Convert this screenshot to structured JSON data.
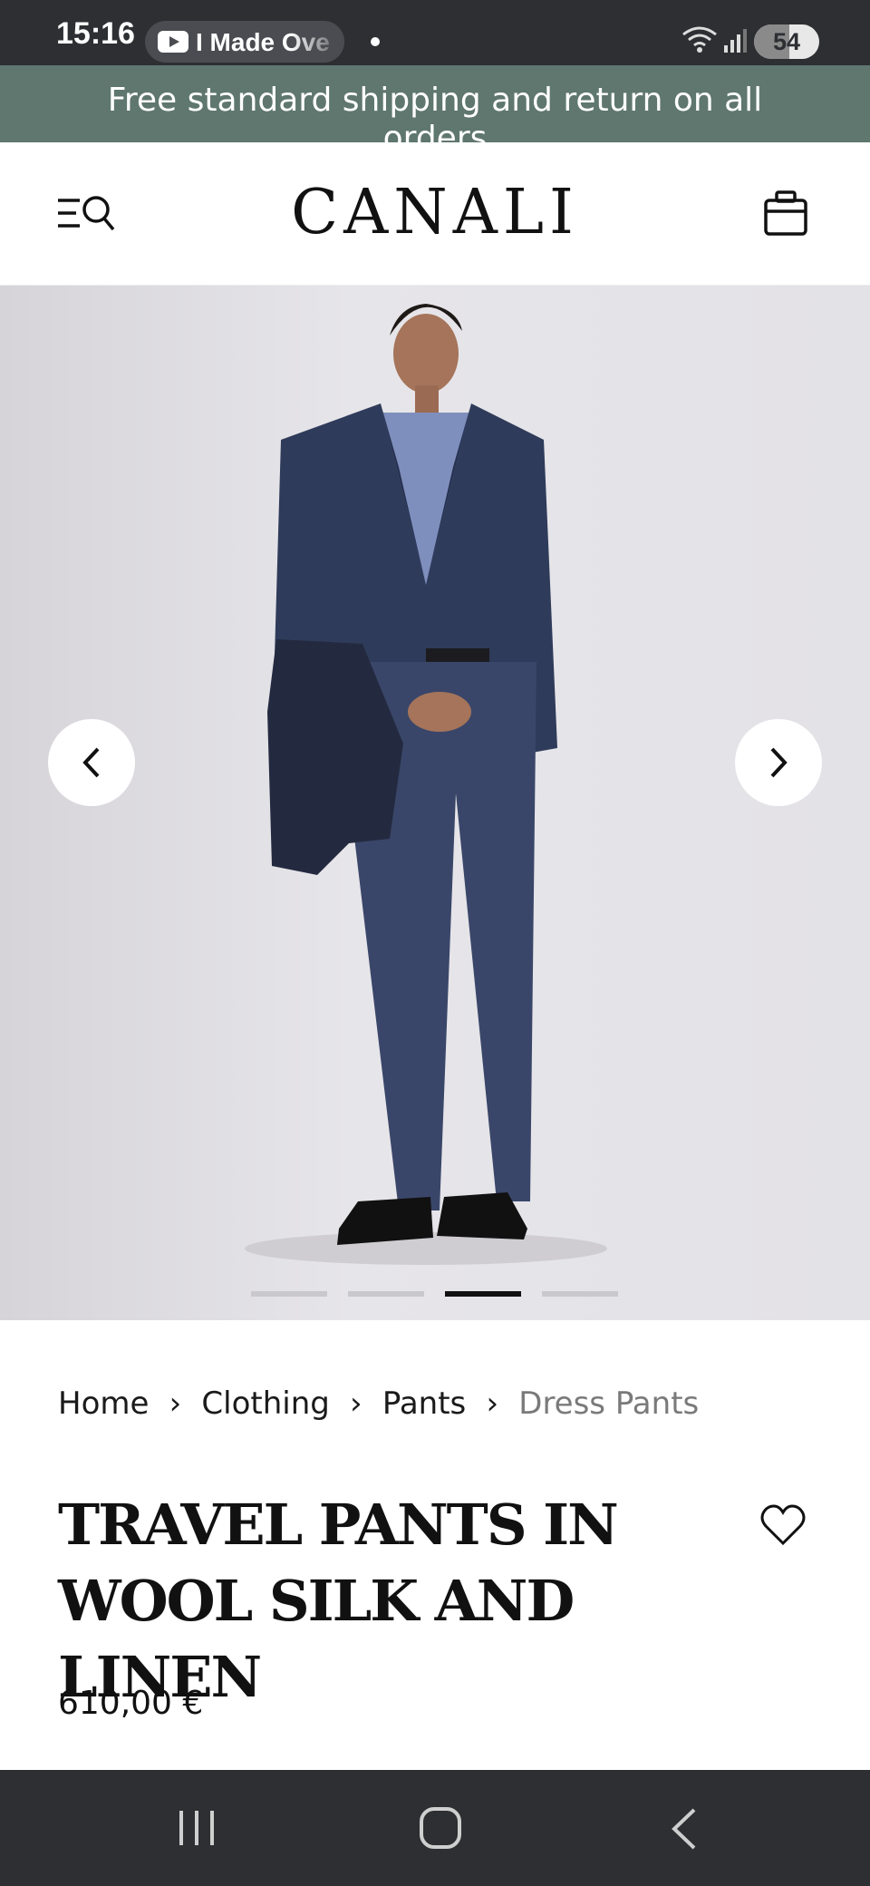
{
  "status_bar": {
    "time": "15:16",
    "media_title": "I Made Ove",
    "battery_level": "54",
    "battery_fraction": 0.54
  },
  "promo": {
    "text": "Free standard shipping and return on all orders"
  },
  "header": {
    "logo": "CANALI"
  },
  "gallery": {
    "slide_count": 4,
    "active_slide": 3
  },
  "breadcrumb": {
    "items": [
      "Home",
      "Clothing",
      "Pants",
      "Dress Pants"
    ],
    "separator": "›"
  },
  "product": {
    "title": "TRAVEL PANTS IN WOOL SILK AND LINEN",
    "price": "610,00 €"
  },
  "colors": {
    "banner": "#5f776f",
    "system_bars": "#2d2f33",
    "breadcrumb_current": "#7a7a7a"
  },
  "icons": {
    "menu": "menu-icon",
    "search": "search-icon",
    "bag": "shopping-bag-icon",
    "prev": "chevron-left-icon",
    "next": "chevron-right-icon",
    "favorite": "heart-icon"
  }
}
